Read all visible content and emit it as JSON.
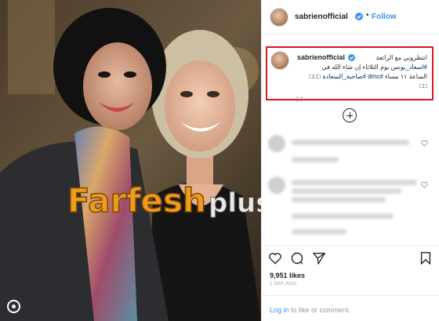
{
  "post": {
    "username": "sabrienofficial",
    "follow_label": "Follow",
    "dot": "•"
  },
  "caption": {
    "username": "sabrienofficial",
    "line1": "انتظروني مع الرائعة",
    "hashtag1": "#اسعاد_يونس",
    "line2_rest": " يوم الثلاثاء إن شاء الله في",
    "line3_start": "الساعة ١١ مساء ",
    "hashtag2": "#dmc",
    "hashtag3": " #صاحبة_السعادة",
    "line3_end": " □□□",
    "line4": "□□"
  },
  "caption_age": "1d",
  "likes": "9,951 likes",
  "date": "1 DAY AGO",
  "footer": {
    "login_link": "Log in",
    "rest": " to like or comment."
  },
  "watermark": {
    "brand": "Farfesh",
    "suffix": "plus.com"
  },
  "icons": {
    "verified": "verified-badge-icon",
    "like": "heart-icon",
    "comment": "comment-icon",
    "share": "share-icon",
    "save": "bookmark-icon",
    "load_more": "plus-circle-icon",
    "photo_badge": "instagram-icon"
  },
  "colors": {
    "accent": "#3897f0",
    "highlight_box": "#d7191f",
    "watermark_orange": "#f29a1c",
    "watermark_white": "#ffffff"
  }
}
